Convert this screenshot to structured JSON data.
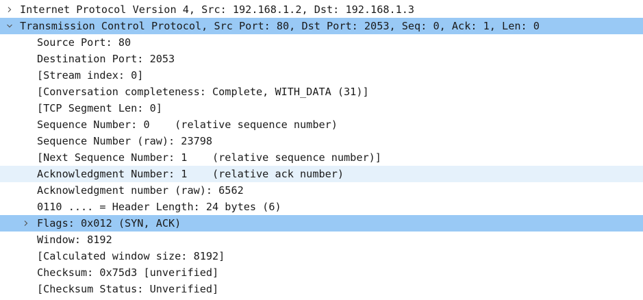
{
  "packet_details": {
    "rows": [
      {
        "text": "Internet Protocol Version 4, Src: 192.168.1.2, Dst: 192.168.1.3",
        "level": 0,
        "expander": "collapsed",
        "state": "normal"
      },
      {
        "text": "Transmission Control Protocol, Src Port: 80, Dst Port: 2053, Seq: 0, Ack: 1, Len: 0",
        "level": 0,
        "expander": "expanded",
        "state": "selected"
      },
      {
        "text": "Source Port: 80",
        "level": 1,
        "expander": "none",
        "state": "normal"
      },
      {
        "text": "Destination Port: 2053",
        "level": 1,
        "expander": "none",
        "state": "normal"
      },
      {
        "text": "[Stream index: 0]",
        "level": 1,
        "expander": "none",
        "state": "normal"
      },
      {
        "text": "[Conversation completeness: Complete, WITH_DATA (31)]",
        "level": 1,
        "expander": "none",
        "state": "normal"
      },
      {
        "text": "[TCP Segment Len: 0]",
        "level": 1,
        "expander": "none",
        "state": "normal"
      },
      {
        "text": "Sequence Number: 0    (relative sequence number)",
        "level": 1,
        "expander": "none",
        "state": "normal"
      },
      {
        "text": "Sequence Number (raw): 23798",
        "level": 1,
        "expander": "none",
        "state": "normal"
      },
      {
        "text": "[Next Sequence Number: 1    (relative sequence number)]",
        "level": 1,
        "expander": "none",
        "state": "normal"
      },
      {
        "text": "Acknowledgment Number: 1    (relative ack number)",
        "level": 1,
        "expander": "none",
        "state": "hover"
      },
      {
        "text": "Acknowledgment number (raw): 6562",
        "level": 1,
        "expander": "none",
        "state": "normal"
      },
      {
        "text": "0110 .... = Header Length: 24 bytes (6)",
        "level": 1,
        "expander": "none",
        "state": "normal"
      },
      {
        "text": "Flags: 0x012 (SYN, ACK)",
        "level": 1,
        "expander": "collapsed",
        "state": "selected"
      },
      {
        "text": "Window: 8192",
        "level": 1,
        "expander": "none",
        "state": "normal"
      },
      {
        "text": "[Calculated window size: 8192]",
        "level": 1,
        "expander": "none",
        "state": "normal"
      },
      {
        "text": "Checksum: 0x75d3 [unverified]",
        "level": 1,
        "expander": "none",
        "state": "normal"
      },
      {
        "text": "[Checksum Status: Unverified]",
        "level": 1,
        "expander": "none",
        "state": "normal"
      }
    ]
  },
  "icons": {
    "collapsed": "chevron-right-icon",
    "expanded": "chevron-down-icon"
  },
  "colors": {
    "selected_bg": "#99c9f5",
    "hover_bg": "#e5f1fb",
    "text": "#1a1a1a",
    "chevron": "#555555"
  }
}
